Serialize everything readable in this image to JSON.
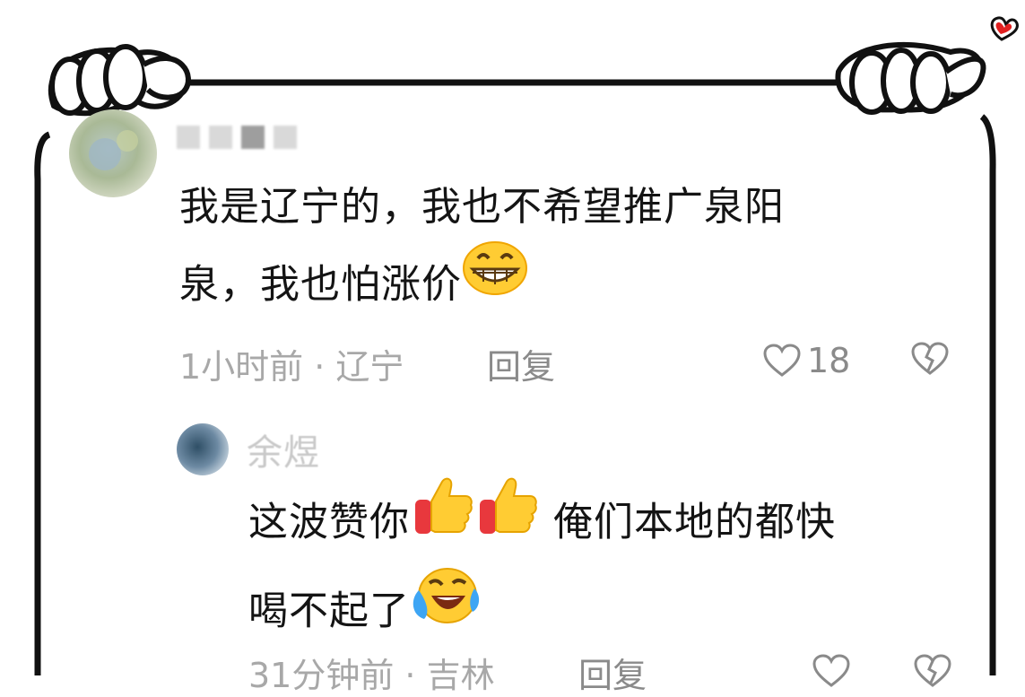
{
  "comments": [
    {
      "username": "",
      "text_line1": "我是辽宁的，我也不希望推广泉阳",
      "text_line2": "泉，我也怕涨价",
      "emoji": "grin-emoji",
      "time_location": "1小时前 · 辽宁",
      "reply_label": "回复",
      "like_count": "18"
    },
    {
      "username": "余煜",
      "text_part1": "这波赞你",
      "text_part2": "俺们本地的都快",
      "text_line2": "喝不起了",
      "emojis": [
        "thumbs-up-emoji",
        "thumbs-up-emoji",
        "laughing-tears-emoji"
      ],
      "time_location": "31分钟前 · 吉林",
      "reply_label": "回复"
    }
  ],
  "colors": {
    "frame": "#111111",
    "heart_accent": "#e02020",
    "meta_text": "#a8a8a8",
    "emoji_yellow": "#ffcc33"
  }
}
